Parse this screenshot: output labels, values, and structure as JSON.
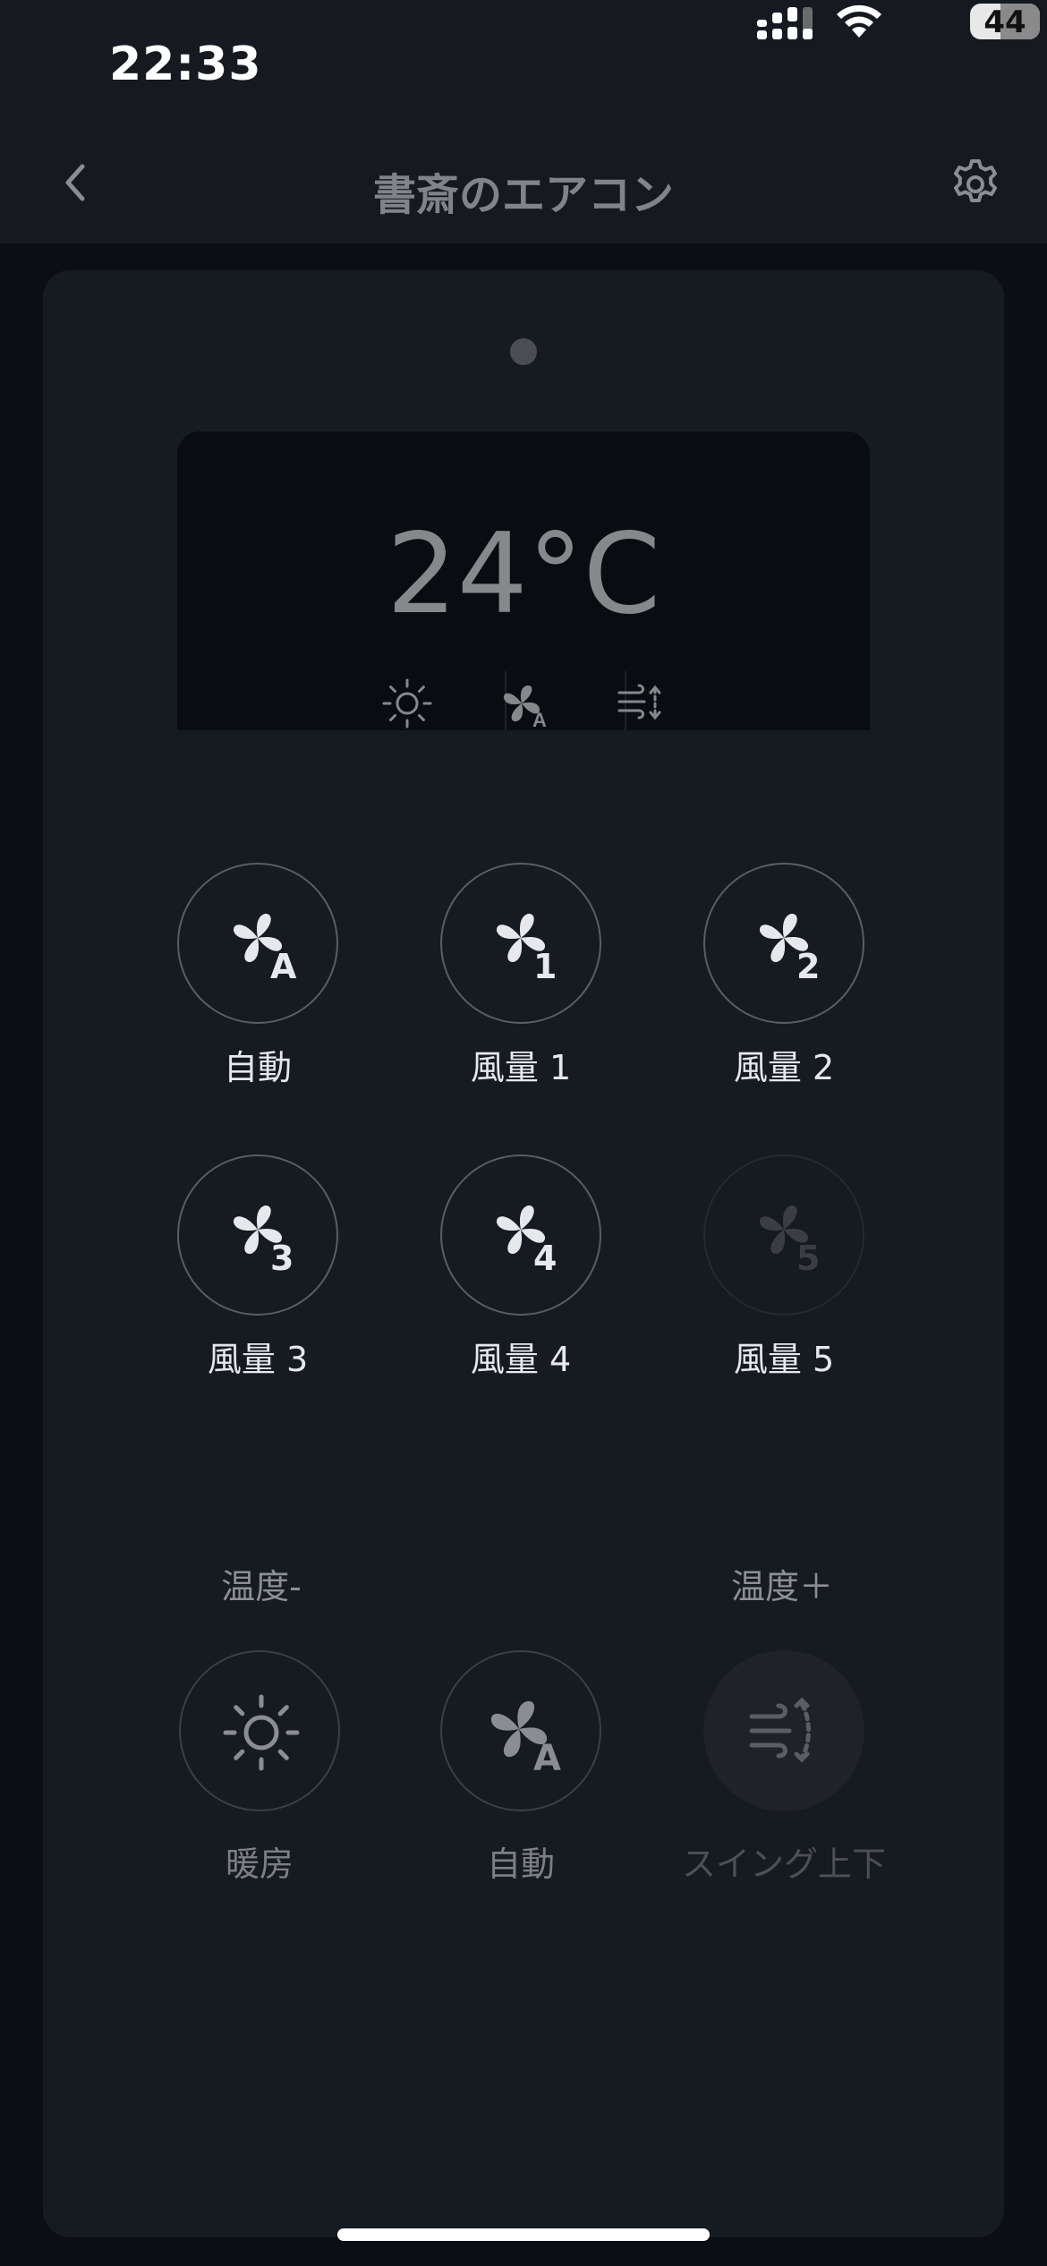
{
  "status_bar": {
    "time": "22:33",
    "battery": "44",
    "battery_level": 0.44
  },
  "header": {
    "title": "書斎のエアコン"
  },
  "display": {
    "temperature": "24°C",
    "mode_icons": [
      "sun-icon",
      "fan-auto-icon",
      "swing-icon"
    ],
    "fan_badge": "A"
  },
  "fan_speed": [
    {
      "label": "自動",
      "badge": "A",
      "enabled": true
    },
    {
      "label": "風量 1",
      "badge": "1",
      "enabled": true
    },
    {
      "label": "風量 2",
      "badge": "2",
      "enabled": true
    },
    {
      "label": "風量 3",
      "badge": "3",
      "enabled": true
    },
    {
      "label": "風量 4",
      "badge": "4",
      "enabled": true
    },
    {
      "label": "風量 5",
      "badge": "5",
      "enabled": false
    }
  ],
  "temperature_controls": {
    "decrease_label": "温度-",
    "increase_label": "温度＋"
  },
  "controls": [
    {
      "label": "暖房",
      "icon": "sun-icon"
    },
    {
      "label": "自動",
      "icon": "fan-icon",
      "badge": "A"
    },
    {
      "label": "スイング上下",
      "icon": "swing-icon"
    }
  ],
  "colors": {
    "background": "#0b0e13",
    "card": "#161a21",
    "display": "#090c11",
    "text": "#e6e8ec",
    "muted": "#80848a"
  }
}
